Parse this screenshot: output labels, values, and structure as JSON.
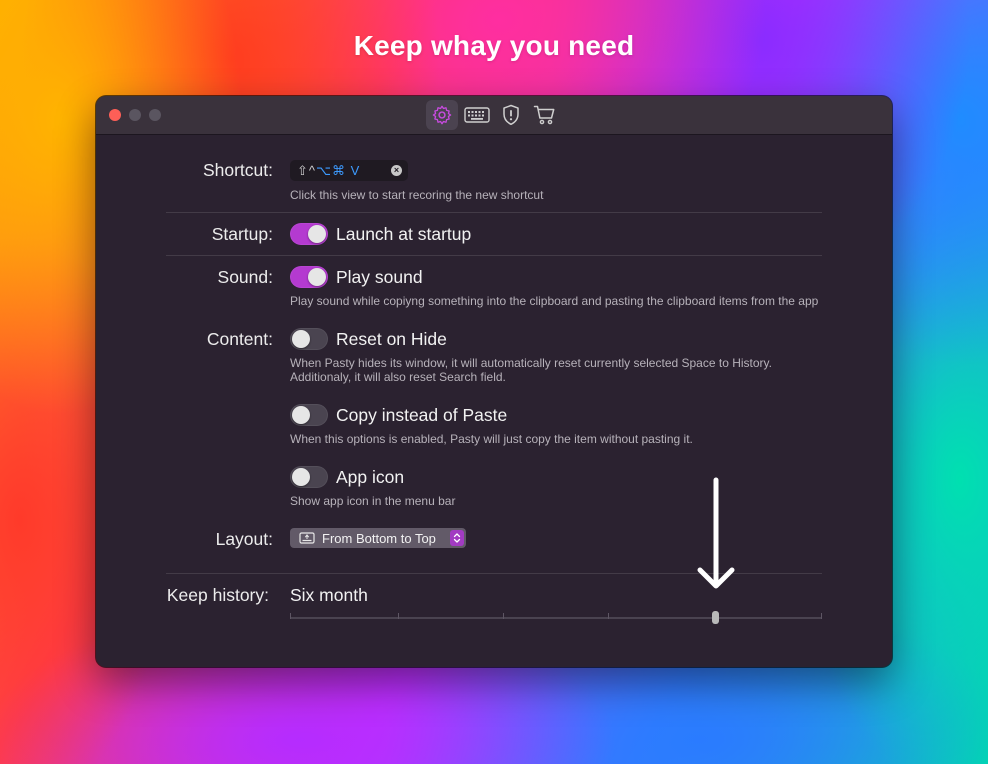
{
  "headline": "Keep whay you need",
  "toolbar": {
    "tabs": [
      {
        "name": "general",
        "icon": "gear-icon",
        "active": true
      },
      {
        "name": "shortcuts",
        "icon": "keyboard-icon",
        "active": false
      },
      {
        "name": "privacy",
        "icon": "shield-exclamation-icon",
        "active": false
      },
      {
        "name": "purchase",
        "icon": "cart-icon",
        "active": false
      }
    ]
  },
  "shortcut": {
    "label": "Shortcut:",
    "keys_mods": "⇧^",
    "keys_mods2": "⌥⌘ V",
    "hint": "Click this view to start recoring the new shortcut"
  },
  "startup": {
    "label": "Startup:",
    "option": "Launch at startup",
    "enabled": true
  },
  "sound": {
    "label": "Sound:",
    "option": "Play sound",
    "enabled": true,
    "desc": "Play sound while copiyng something into the clipboard and pasting the clipboard items from the app"
  },
  "content": {
    "label": "Content:",
    "reset_on_hide": {
      "option": "Reset on Hide",
      "enabled": false,
      "desc1": "When Pasty hides its window, it will automatically reset currently selected Space to History.",
      "desc2": "Additionaly,  it will also reset Search field."
    },
    "copy_instead": {
      "option": "Copy instead of Paste",
      "enabled": false,
      "desc": "When this options is enabled, Pasty will just copy the item without pasting it."
    },
    "app_icon": {
      "option": "App icon",
      "enabled": false,
      "desc": "Show app icon in the menu bar"
    }
  },
  "layout": {
    "label": "Layout:",
    "selected": "From Bottom to Top"
  },
  "history": {
    "label": "Keep history:",
    "value": "Six month",
    "slider_position_fraction": 0.8
  },
  "colors": {
    "accent": "#b43ad0",
    "close": "#fe5f57",
    "shortcut_blue": "#3d9bff"
  }
}
